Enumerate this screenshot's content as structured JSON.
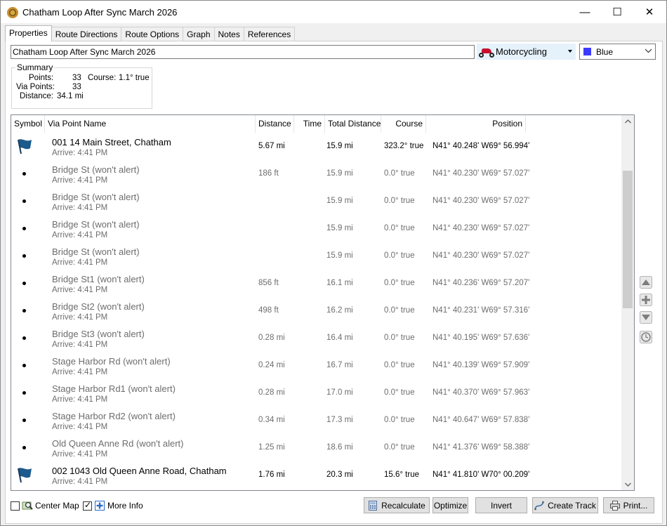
{
  "window": {
    "title": "Chatham Loop After Sync March 2026",
    "minimize": "—",
    "maximize": "☐",
    "close": "✕"
  },
  "tabs": [
    {
      "label": "Properties",
      "active": true
    },
    {
      "label": "Route Directions"
    },
    {
      "label": "Route Options"
    },
    {
      "label": "Graph"
    },
    {
      "label": "Notes"
    },
    {
      "label": "References"
    }
  ],
  "route_name": "Chatham Loop After Sync March 2026",
  "mode": {
    "label": "Motorcycling",
    "icon": "motorcycle-icon"
  },
  "color": {
    "label": "Blue",
    "value": "#3b3bff"
  },
  "summary": {
    "legend": "Summary",
    "points_label": "Points:",
    "points_value": "33",
    "course_label": "Course:",
    "course_value": "1.1° true",
    "via_label": "Via Points:",
    "via_value": "33",
    "distance_label": "Distance:",
    "distance_value": "34.1 mi"
  },
  "table": {
    "headers": [
      "Symbol",
      "Via Point Name",
      "Distance",
      "Time",
      "Total Distance",
      "Course",
      "Position"
    ],
    "rows": [
      {
        "type": "flag",
        "name": "001  14 Main Street, Chatham",
        "arrive": "Arrive: 4:41 PM",
        "distance": "5.67 mi",
        "time": "",
        "total": "15.9 mi",
        "course": "323.2° true",
        "position": "N41° 40.248' W69° 56.994'"
      },
      {
        "type": "dot",
        "name": "Bridge St (won't alert)",
        "arrive": "Arrive: 4:41 PM",
        "distance": "186 ft",
        "time": "",
        "total": "15.9 mi",
        "course": "0.0° true",
        "position": "N41° 40.230' W69° 57.027'"
      },
      {
        "type": "dot",
        "name": "Bridge St (won't alert)",
        "arrive": "Arrive: 4:41 PM",
        "distance": "",
        "time": "",
        "total": "15.9 mi",
        "course": "0.0° true",
        "position": "N41° 40.230' W69° 57.027'"
      },
      {
        "type": "dot",
        "name": "Bridge St (won't alert)",
        "arrive": "Arrive: 4:41 PM",
        "distance": "",
        "time": "",
        "total": "15.9 mi",
        "course": "0.0° true",
        "position": "N41° 40.230' W69° 57.027'"
      },
      {
        "type": "dot",
        "name": "Bridge St (won't alert)",
        "arrive": "Arrive: 4:41 PM",
        "distance": "",
        "time": "",
        "total": "15.9 mi",
        "course": "0.0° true",
        "position": "N41° 40.230' W69° 57.027'"
      },
      {
        "type": "dot",
        "name": "Bridge St1 (won't alert)",
        "arrive": "Arrive: 4:41 PM",
        "distance": "856 ft",
        "time": "",
        "total": "16.1 mi",
        "course": "0.0° true",
        "position": "N41° 40.236' W69° 57.207'"
      },
      {
        "type": "dot",
        "name": "Bridge St2 (won't alert)",
        "arrive": "Arrive: 4:41 PM",
        "distance": "498 ft",
        "time": "",
        "total": "16.2 mi",
        "course": "0.0° true",
        "position": "N41° 40.231' W69° 57.316'"
      },
      {
        "type": "dot",
        "name": "Bridge St3 (won't alert)",
        "arrive": "Arrive: 4:41 PM",
        "distance": "0.28 mi",
        "time": "",
        "total": "16.4 mi",
        "course": "0.0° true",
        "position": "N41° 40.195' W69° 57.636'"
      },
      {
        "type": "dot",
        "name": "Stage Harbor Rd (won't alert)",
        "arrive": "Arrive: 4:41 PM",
        "distance": "0.24 mi",
        "time": "",
        "total": "16.7 mi",
        "course": "0.0° true",
        "position": "N41° 40.139' W69° 57.909'"
      },
      {
        "type": "dot",
        "name": "Stage Harbor Rd1 (won't alert)",
        "arrive": "Arrive: 4:41 PM",
        "distance": "0.28 mi",
        "time": "",
        "total": "17.0 mi",
        "course": "0.0° true",
        "position": "N41° 40.370' W69° 57.963'"
      },
      {
        "type": "dot",
        "name": "Stage Harbor Rd2 (won't alert)",
        "arrive": "Arrive: 4:41 PM",
        "distance": "0.34 mi",
        "time": "",
        "total": "17.3 mi",
        "course": "0.0° true",
        "position": "N41° 40.647' W69° 57.838'"
      },
      {
        "type": "dot",
        "name": "Old Queen Anne Rd (won't alert)",
        "arrive": "Arrive: 4:41 PM",
        "distance": "1.25 mi",
        "time": "",
        "total": "18.6 mi",
        "course": "0.0° true",
        "position": "N41° 41.376' W69° 58.388'"
      },
      {
        "type": "flag",
        "name": "002  1043 Old Queen Anne Road, Chatham",
        "arrive": "Arrive: 4:41 PM",
        "distance": "1.76 mi",
        "time": "",
        "total": "20.3 mi",
        "course": "15.6° true",
        "position": "N41° 41.810' W70° 00.209'"
      }
    ]
  },
  "footer": {
    "center_map": "Center Map",
    "center_map_checked": false,
    "more_info": "More Info",
    "more_info_checked": true,
    "buttons": {
      "recalculate": "Recalculate",
      "optimize": "Optimize",
      "invert": "Invert",
      "create_track": "Create Track",
      "print": "Print..."
    }
  }
}
